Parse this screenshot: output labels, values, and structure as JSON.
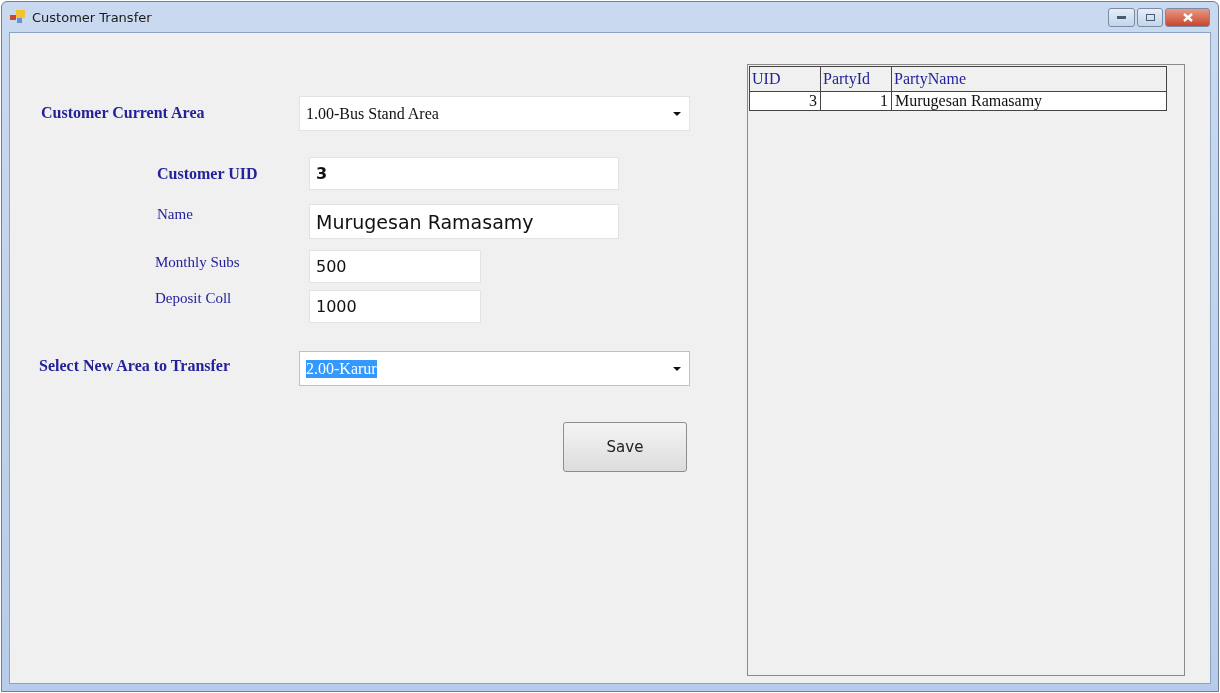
{
  "window": {
    "title": "Customer Transfer"
  },
  "form": {
    "current_area": {
      "label": "Customer Current Area",
      "value": "1.00-Bus Stand Area"
    },
    "customer_uid": {
      "label": "Customer UID",
      "value": "3"
    },
    "name": {
      "label": "Name",
      "value": "Murugesan Ramasamy"
    },
    "monthly_subs": {
      "label": "Monthly Subs",
      "value": "500"
    },
    "deposit_coll": {
      "label": "Deposit Coll",
      "value": "1000"
    },
    "new_area": {
      "label": "Select New Area to Transfer",
      "value": "2.00-Karur",
      "selected": true
    },
    "save_button": "Save"
  },
  "table": {
    "columns": [
      "UID",
      "PartyId",
      "PartyName"
    ],
    "rows": [
      [
        "3",
        "1",
        "Murugesan Ramasamy"
      ]
    ]
  }
}
